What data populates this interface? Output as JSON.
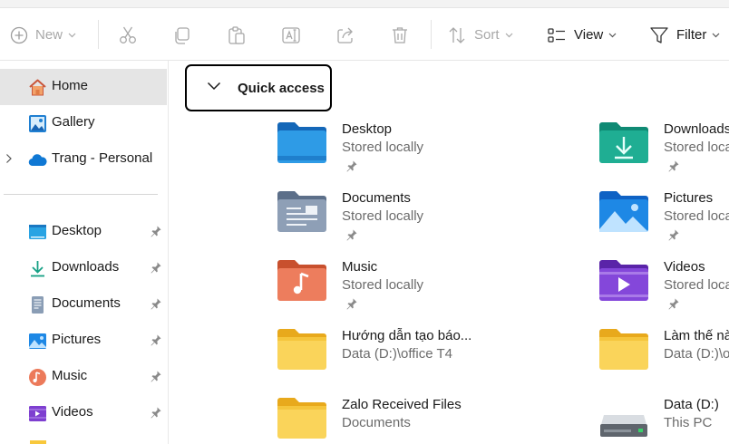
{
  "toolbar": {
    "new_label": "New",
    "sort_label": "Sort",
    "view_label": "View",
    "filter_label": "Filter"
  },
  "sidebar": {
    "top_items": [
      {
        "label": "Home",
        "icon": "home-icon",
        "selected": true
      },
      {
        "label": "Gallery",
        "icon": "gallery-icon"
      },
      {
        "label": "Trang - Personal",
        "icon": "onedrive-cloud-icon"
      }
    ],
    "pinned_items": [
      {
        "label": "Desktop",
        "icon": "desktop-icon"
      },
      {
        "label": "Downloads",
        "icon": "downloads-icon"
      },
      {
        "label": "Documents",
        "icon": "documents-icon"
      },
      {
        "label": "Pictures",
        "icon": "pictures-icon"
      },
      {
        "label": "Music",
        "icon": "music-icon"
      },
      {
        "label": "Videos",
        "icon": "videos-icon"
      }
    ]
  },
  "quick_access": {
    "header": "Quick access",
    "items": [
      {
        "name": "Desktop",
        "sub": "Stored locally",
        "icon": "desktop-folder-icon",
        "pinned": true
      },
      {
        "name": "Downloads",
        "sub": "Stored locally",
        "icon": "downloads-folder-icon",
        "pinned": true
      },
      {
        "name": "Documents",
        "sub": "Stored locally",
        "icon": "documents-folder-icon",
        "pinned": true
      },
      {
        "name": "Pictures",
        "sub": "Stored locally",
        "icon": "pictures-folder-icon",
        "pinned": true
      },
      {
        "name": "Music",
        "sub": "Stored locally",
        "icon": "music-folder-icon",
        "pinned": true
      },
      {
        "name": "Videos",
        "sub": "Stored locally",
        "icon": "videos-folder-icon",
        "pinned": true
      },
      {
        "name": "Hướng dẫn tạo báo...",
        "sub": "Data (D:)\\office T4",
        "icon": "folder-icon"
      },
      {
        "name": "Làm thế nà",
        "sub": "Data (D:)\\o",
        "icon": "folder-icon"
      },
      {
        "name": "Zalo Received Files",
        "sub": "Documents",
        "icon": "folder-icon"
      },
      {
        "name": "Data (D:)",
        "sub": "This PC",
        "icon": "drive-icon"
      }
    ]
  },
  "colors": {
    "accent": "#0067c0",
    "folder_yellow": "#f8c83c",
    "selected_bg": "#e5e5e5"
  }
}
